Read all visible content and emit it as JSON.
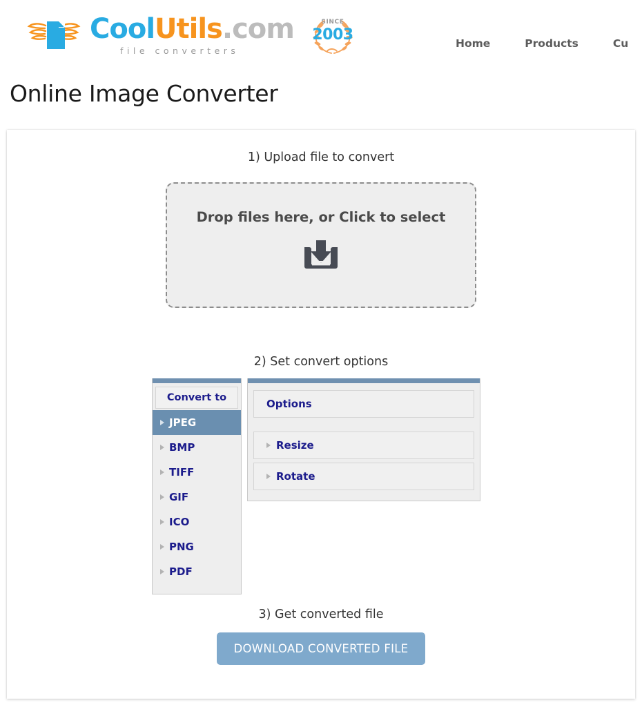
{
  "header": {
    "logo": {
      "word_cool": "Cool",
      "word_utils": "Utils",
      "word_com": ".com",
      "tagline": "file converters"
    },
    "badge": {
      "since": "SINCE",
      "year": "2003"
    },
    "nav": [
      {
        "label": "Home"
      },
      {
        "label": "Products"
      },
      {
        "label": "Cu"
      }
    ]
  },
  "page": {
    "title": "Online Image Converter"
  },
  "steps": {
    "step1": "1) Upload file to convert",
    "step2": "2) Set convert options",
    "step3": "3) Get converted file"
  },
  "dropzone": {
    "text": "Drop files here, or Click to select",
    "icon": "download-inbox-icon"
  },
  "convert": {
    "formats_header": "Convert to",
    "formats": [
      {
        "label": "JPEG",
        "selected": true
      },
      {
        "label": "BMP",
        "selected": false
      },
      {
        "label": "TIFF",
        "selected": false
      },
      {
        "label": "GIF",
        "selected": false
      },
      {
        "label": "ICO",
        "selected": false
      },
      {
        "label": "PNG",
        "selected": false
      },
      {
        "label": "PDF",
        "selected": false
      }
    ],
    "options": [
      {
        "label": "Options",
        "has_caret": false
      },
      {
        "label": "Resize",
        "has_caret": true
      },
      {
        "label": "Rotate",
        "has_caret": true
      }
    ]
  },
  "download": {
    "label": "DOWNLOAD CONVERTED FILE"
  },
  "colors": {
    "brand_blue": "#29abe2",
    "brand_orange": "#f7941e",
    "panel_bar": "#6f90b0",
    "selected_row": "#6a8fb0",
    "download_btn": "#7fa9cc",
    "link_navy": "#1c1c8c"
  }
}
